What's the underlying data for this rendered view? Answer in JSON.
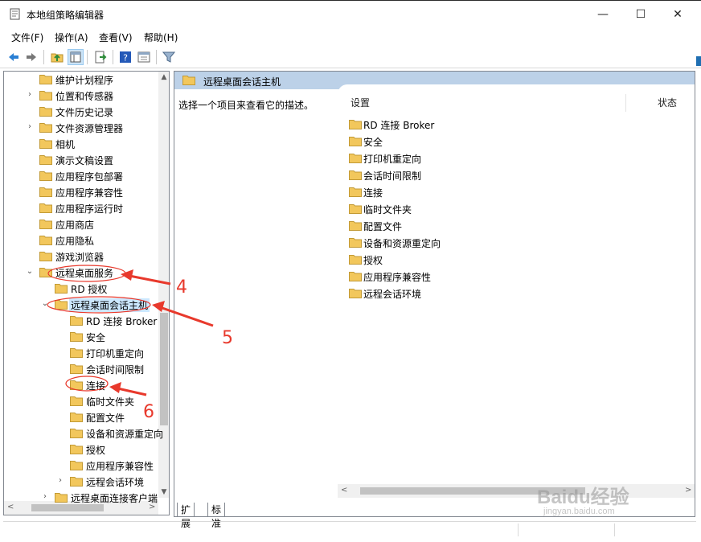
{
  "window": {
    "title": "本地组策略编辑器",
    "minimize": "—",
    "maximize": "☐",
    "close": "✕"
  },
  "menu": [
    "文件(F)",
    "操作(A)",
    "查看(V)",
    "帮助(H)"
  ],
  "toolbar_icons": [
    "back-icon",
    "forward-icon",
    "up-folder-icon",
    "show-hide-tree-icon",
    "export-list-icon",
    "help-icon",
    "properties-icon",
    "filter-icon"
  ],
  "tree": {
    "items": [
      {
        "label": "维护计划程序",
        "expander": ""
      },
      {
        "label": "位置和传感器",
        "expander": ">"
      },
      {
        "label": "文件历史记录",
        "expander": ""
      },
      {
        "label": "文件资源管理器",
        "expander": ">"
      },
      {
        "label": "相机",
        "expander": ""
      },
      {
        "label": "演示文稿设置",
        "expander": ""
      },
      {
        "label": "应用程序包部署",
        "expander": ""
      },
      {
        "label": "应用程序兼容性",
        "expander": ""
      },
      {
        "label": "应用程序运行时",
        "expander": ""
      },
      {
        "label": "应用商店",
        "expander": ""
      },
      {
        "label": "应用隐私",
        "expander": ""
      },
      {
        "label": "游戏浏览器",
        "expander": ""
      },
      {
        "label": "远程桌面服务",
        "expander": "v"
      },
      {
        "label": "RD 授权",
        "expander": ""
      },
      {
        "label": "远程桌面会话主机",
        "expander": "v"
      },
      {
        "label": "RD 连接 Broker",
        "expander": ""
      },
      {
        "label": "安全",
        "expander": ""
      },
      {
        "label": "打印机重定向",
        "expander": ""
      },
      {
        "label": "会话时间限制",
        "expander": ""
      },
      {
        "label": "连接",
        "expander": ""
      },
      {
        "label": "临时文件夹",
        "expander": ""
      },
      {
        "label": "配置文件",
        "expander": ""
      },
      {
        "label": "设备和资源重定向",
        "expander": ""
      },
      {
        "label": "授权",
        "expander": ""
      },
      {
        "label": "应用程序兼容性",
        "expander": ""
      },
      {
        "label": "远程会话环境",
        "expander": ">"
      },
      {
        "label": "远程桌面连接客户端",
        "expander": ">"
      }
    ]
  },
  "right_pane": {
    "header": "远程桌面会话主机",
    "description": "选择一个项目来查看它的描述。",
    "columns": {
      "setting": "设置",
      "state": "状态"
    },
    "items": [
      "RD 连接 Broker",
      "安全",
      "打印机重定向",
      "会话时间限制",
      "连接",
      "临时文件夹",
      "配置文件",
      "设备和资源重定向",
      "授权",
      "应用程序兼容性",
      "远程会话环境"
    ]
  },
  "tabs": [
    "扩展",
    "标准"
  ],
  "annotations": [
    "4",
    "5",
    "6"
  ],
  "watermark": {
    "brand": "Baidu经验",
    "url": "jingyan.baidu.com"
  },
  "colors": {
    "header_bg": "#bcd1e8",
    "selection": "#cce8ff",
    "annotation": "#e8392c",
    "folder": "#f2c75c"
  }
}
